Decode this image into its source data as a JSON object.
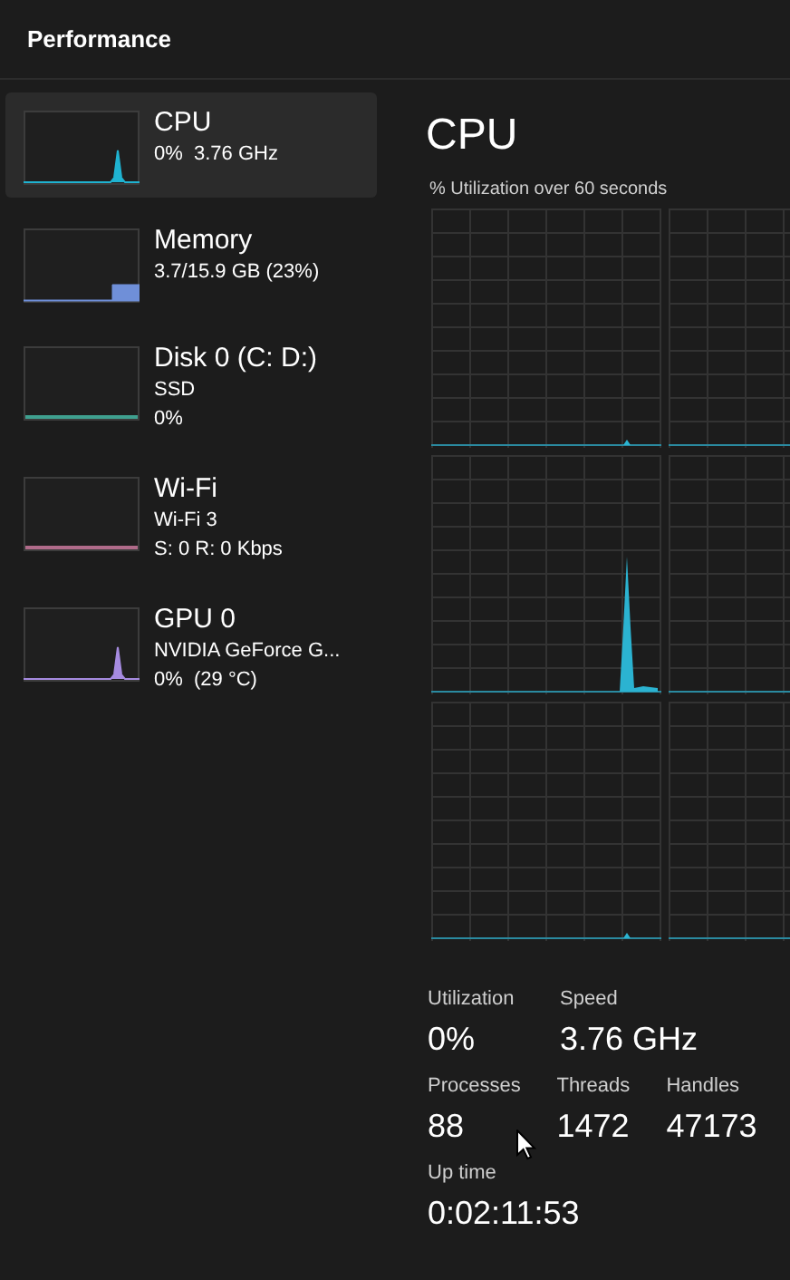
{
  "header": {
    "title": "Performance"
  },
  "sidebar": {
    "items": [
      {
        "name": "CPU",
        "lines": [
          "0%  3.76 GHz"
        ],
        "color": "#1fb3d1",
        "selected": true,
        "kind": "spike"
      },
      {
        "name": "Memory",
        "lines": [
          "3.7/15.9 GB (23%)"
        ],
        "color": "#6f8fd8",
        "selected": false,
        "kind": "block"
      },
      {
        "name": "Disk 0 (C: D:)",
        "lines": [
          "SSD",
          "0%"
        ],
        "color": "#3fa08f",
        "selected": false,
        "kind": "flat"
      },
      {
        "name": "Wi-Fi",
        "lines": [
          "Wi-Fi 3",
          "S: 0 R: 0 Kbps"
        ],
        "color": "#b06b8a",
        "selected": false,
        "kind": "flat"
      },
      {
        "name": "GPU 0",
        "lines": [
          "NVIDIA GeForce G...",
          "0%  (29 °C)"
        ],
        "color": "#a68be0",
        "selected": false,
        "kind": "spike"
      }
    ]
  },
  "main": {
    "title": "CPU",
    "subtitle": "% Utilization over 60 seconds",
    "core_graphs": [
      {
        "kind": "blip"
      },
      {
        "kind": "flat"
      },
      {
        "kind": "peak"
      },
      {
        "kind": "flat"
      },
      {
        "kind": "blip"
      },
      {
        "kind": "flat"
      }
    ],
    "stats": [
      [
        {
          "label": "Utilization",
          "value": "0%"
        },
        {
          "label": "Speed",
          "value": "3.76 GHz"
        }
      ],
      [
        {
          "label": "Processes",
          "value": "88"
        },
        {
          "label": "Threads",
          "value": "1472"
        },
        {
          "label": "Handles",
          "value": "47173"
        }
      ],
      [
        {
          "label": "Up time",
          "value": "0:02:11:53"
        }
      ]
    ]
  }
}
